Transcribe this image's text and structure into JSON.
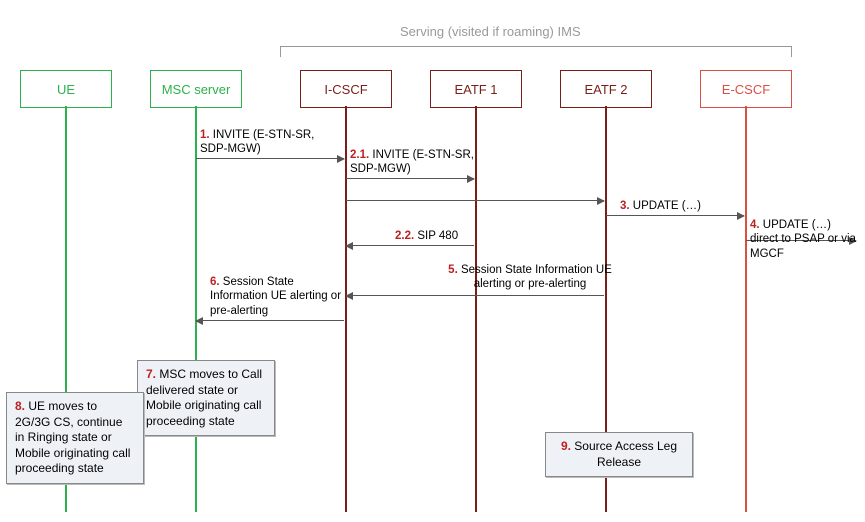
{
  "serving_label": "Serving (visited if roaming) IMS",
  "actors": {
    "ue": "UE",
    "msc": "MSC server",
    "icscf": "I-CSCF",
    "eatf1": "EATF 1",
    "eatf2": "EATF 2",
    "ecscf": "E-CSCF"
  },
  "messages": {
    "m1_num": "1.",
    "m1_txt": " INVITE (E-STN-SR, SDP-MGW)",
    "m21_num": "2.1.",
    "m21_txt": " INVITE (E-STN-SR, SDP-MGW)",
    "m21b_arrow_only": true,
    "m3_num": "3.",
    "m3_txt": " UPDATE (…)",
    "m4_num": "4.",
    "m4_txt": " UPDATE  (…) direct to PSAP or via MGCF",
    "m22_num": "2.2.",
    "m22_txt": " SIP 480",
    "m5_num": "5.",
    "m5_txt": " Session State Information UE alerting or pre-alerting",
    "m6_num": "6.",
    "m6_txt": " Session State Information UE alerting or pre-alerting"
  },
  "notes": {
    "n7_num": "7.",
    "n7_txt": " MSC moves to Call delivered state or Mobile originating call proceeding state",
    "n8_num": "8.",
    "n8_txt": " UE moves to 2G/3G CS, continue in Ringing state or Mobile originating call proceeding state",
    "n9_num": "9.",
    "n9_txt": " Source Access Leg Release"
  },
  "chart_data": {
    "type": "sequence-diagram",
    "group": {
      "label": "Serving (visited if roaming) IMS",
      "actors": [
        "I-CSCF",
        "EATF 1",
        "EATF 2",
        "E-CSCF"
      ]
    },
    "actors": [
      "UE",
      "MSC server",
      "I-CSCF",
      "EATF 1",
      "EATF 2",
      "E-CSCF"
    ],
    "events": [
      {
        "step": "1",
        "from": "MSC server",
        "to": "I-CSCF",
        "text": "INVITE (E-STN-SR, SDP-MGW)"
      },
      {
        "step": "2.1",
        "from": "I-CSCF",
        "to": "EATF 1",
        "text": "INVITE (E-STN-SR, SDP-MGW)"
      },
      {
        "step": "2.1b",
        "from": "I-CSCF",
        "to": "EATF 2",
        "text": ""
      },
      {
        "step": "3",
        "from": "EATF 2",
        "to": "E-CSCF",
        "text": "UPDATE (…)"
      },
      {
        "step": "4",
        "from": "E-CSCF",
        "to": "external",
        "text": "UPDATE (…) direct to PSAP or via MGCF"
      },
      {
        "step": "2.2",
        "from": "EATF 1",
        "to": "I-CSCF",
        "text": "SIP 480"
      },
      {
        "step": "5",
        "from": "EATF 2",
        "to": "I-CSCF",
        "text": "Session State Information UE alerting or pre-alerting"
      },
      {
        "step": "6",
        "from": "I-CSCF",
        "to": "MSC server",
        "text": "Session State Information UE alerting or pre-alerting"
      },
      {
        "step": "7",
        "actor": "MSC server",
        "type": "note",
        "text": "MSC moves to Call delivered state or Mobile originating call proceeding state"
      },
      {
        "step": "8",
        "actor": "UE",
        "type": "note",
        "text": "UE moves to 2G/3G CS, continue in Ringing state or Mobile originating call proceeding state"
      },
      {
        "step": "9",
        "actor": "EATF 2",
        "type": "note",
        "text": "Source Access Leg Release"
      }
    ]
  }
}
